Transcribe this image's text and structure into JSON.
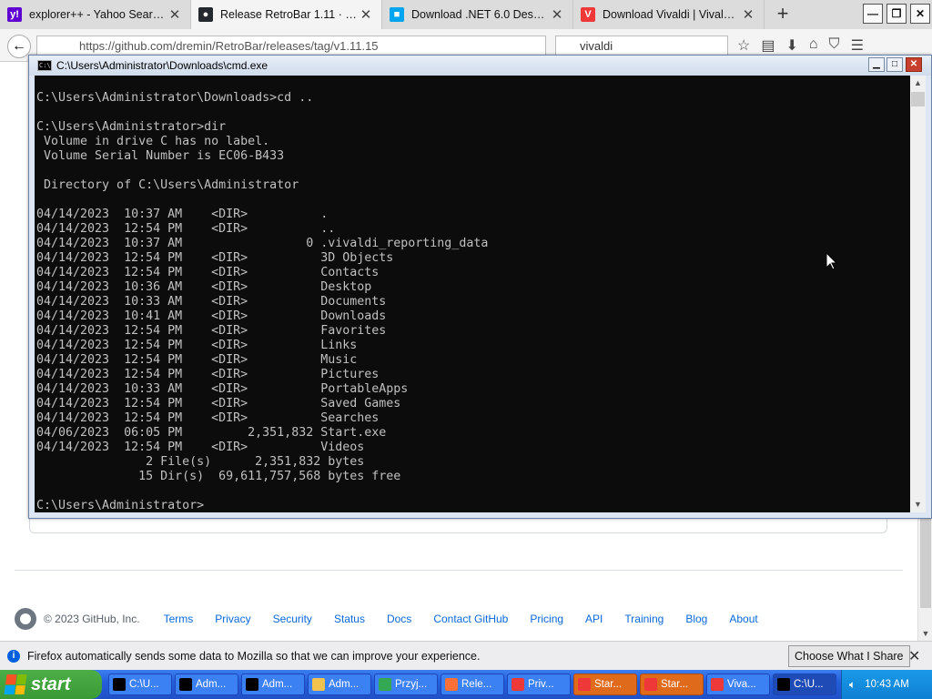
{
  "browser": {
    "tabs": [
      {
        "title": "explorer++ - Yahoo Searc...",
        "icon": "yahoo-icon",
        "color": "#5f01d1",
        "glyph": "y!"
      },
      {
        "title": "Release RetroBar 1.11 · dre...",
        "icon": "github-icon",
        "color": "#24292f",
        "glyph": "●"
      },
      {
        "title": "Download .NET 6.0 Deskto...",
        "icon": "microsoft-icon",
        "color": "#00a4ef",
        "glyph": "■"
      },
      {
        "title": "Download Vivaldi | Vivaldi ...",
        "icon": "vivaldi-icon",
        "color": "#ef3939",
        "glyph": "V"
      }
    ],
    "new_tab": "+",
    "window_buttons": {
      "minimize": "—",
      "restore": "❐",
      "close": "✕"
    },
    "url": "https://github.com/dremin/RetroBar/releases/tag/v1.11.15",
    "search_text": "vivaldi"
  },
  "console": {
    "title": "C:\\Users\\Administrator\\Downloads\\cmd.exe",
    "lines": [
      "",
      "C:\\Users\\Administrator\\Downloads>cd ..",
      "",
      "C:\\Users\\Administrator>dir",
      " Volume in drive C has no label.",
      " Volume Serial Number is EC06-B433",
      "",
      " Directory of C:\\Users\\Administrator",
      "",
      "04/14/2023  10:37 AM    <DIR>          .",
      "04/14/2023  12:54 PM    <DIR>          ..",
      "04/14/2023  10:37 AM                 0 .vivaldi_reporting_data",
      "04/14/2023  12:54 PM    <DIR>          3D Objects",
      "04/14/2023  12:54 PM    <DIR>          Contacts",
      "04/14/2023  10:36 AM    <DIR>          Desktop",
      "04/14/2023  10:33 AM    <DIR>          Documents",
      "04/14/2023  10:41 AM    <DIR>          Downloads",
      "04/14/2023  12:54 PM    <DIR>          Favorites",
      "04/14/2023  12:54 PM    <DIR>          Links",
      "04/14/2023  12:54 PM    <DIR>          Music",
      "04/14/2023  12:54 PM    <DIR>          Pictures",
      "04/14/2023  10:33 AM    <DIR>          PortableApps",
      "04/14/2023  12:54 PM    <DIR>          Saved Games",
      "04/14/2023  12:54 PM    <DIR>          Searches",
      "04/06/2023  06:05 PM         2,351,832 Start.exe",
      "04/14/2023  12:54 PM    <DIR>          Videos",
      "               2 File(s)      2,351,832 bytes",
      "              15 Dir(s)  69,611,757,568 bytes free",
      "",
      "C:\\Users\\Administrator>"
    ]
  },
  "footer": {
    "copyright": "© 2023 GitHub, Inc.",
    "links": [
      "Terms",
      "Privacy",
      "Security",
      "Status",
      "Docs",
      "Contact GitHub",
      "Pricing",
      "API",
      "Training",
      "Blog",
      "About"
    ]
  },
  "notification": {
    "message": "Firefox automatically sends some data to Mozilla so that we can improve your experience.",
    "button": "Choose What I Share"
  },
  "taskbar": {
    "start_label": "start",
    "items": [
      {
        "label": "C:\\U...",
        "icon": "cmd-icon",
        "color": "#000000",
        "variant": "normal"
      },
      {
        "label": "Adm...",
        "icon": "cmd-icon",
        "color": "#000000",
        "variant": "normal"
      },
      {
        "label": "Adm...",
        "icon": "cmd-icon",
        "color": "#000000",
        "variant": "normal"
      },
      {
        "label": "Adm...",
        "icon": "folder-icon",
        "color": "#f2c14e",
        "variant": "normal"
      },
      {
        "label": "Przyj...",
        "icon": "chrome-icon",
        "color": "#34a853",
        "variant": "normal"
      },
      {
        "label": "Rele...",
        "icon": "firefox-icon",
        "color": "#ff7139",
        "variant": "normal"
      },
      {
        "label": "Priv...",
        "icon": "vivaldi-icon",
        "color": "#ef3939",
        "variant": "normal"
      },
      {
        "label": "Star...",
        "icon": "vivaldi-icon",
        "color": "#ef3939",
        "variant": "orange"
      },
      {
        "label": "Star...",
        "icon": "vivaldi-icon",
        "color": "#ef3939",
        "variant": "orange"
      },
      {
        "label": "Viva...",
        "icon": "vivaldi-icon",
        "color": "#ef3939",
        "variant": "normal"
      },
      {
        "label": "C:\\U...",
        "icon": "cmd-icon",
        "color": "#000000",
        "variant": "active"
      }
    ],
    "clock": "10:43 AM"
  }
}
